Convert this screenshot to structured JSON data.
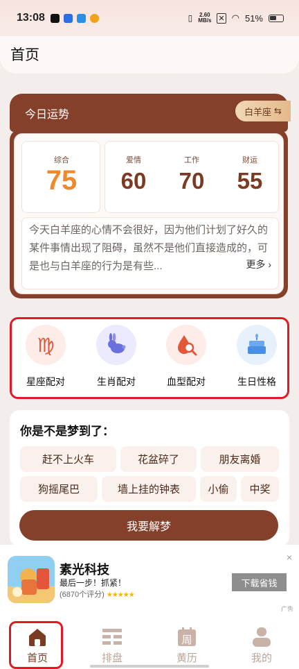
{
  "status": {
    "time": "13:08",
    "net_speed": "2.60",
    "net_unit": "MB/s",
    "battery": "51%"
  },
  "header": {
    "title": "首页"
  },
  "fortune": {
    "title": "今日运势",
    "zodiac": "白羊座",
    "zodiac_icon": "⇆",
    "scores": [
      {
        "label": "综合",
        "value": "75"
      },
      {
        "label": "爱情",
        "value": "60"
      },
      {
        "label": "工作",
        "value": "70"
      },
      {
        "label": "财运",
        "value": "55"
      }
    ],
    "description": "今天白羊座的心情不会很好，因为他们计划了好久的某件事情出现了阻碍，虽然不是他们直接造成的，可是也与白羊座的行为是有些...",
    "more": "更多 ›"
  },
  "tools": [
    {
      "label": "星座配对",
      "icon": "virgo-sign-icon",
      "color": "#e2563a",
      "bg": "#fdece7"
    },
    {
      "label": "生肖配对",
      "icon": "rabbit-icon",
      "color": "#6b6fe0",
      "bg": "#ecebfd"
    },
    {
      "label": "血型配对",
      "icon": "blood-drop-search-icon",
      "color": "#e2563a",
      "bg": "#fdece7"
    },
    {
      "label": "生日性格",
      "icon": "birthday-cake-icon",
      "color": "#4a90e2",
      "bg": "#e6f1fc"
    }
  ],
  "dream": {
    "title": "你是不是梦到了：",
    "chips": [
      "赶不上火车",
      "花盆碎了",
      "朋友离婚",
      "狗摇尾巴",
      "墙上挂的钟表",
      "小偷",
      "中奖"
    ],
    "button": "我要解梦"
  },
  "ad": {
    "title": "素光科技",
    "subtitle": "最后一步！抓紧！",
    "rating": "(6870个评分)",
    "stars": "★★★★★",
    "button": "下载省钱",
    "tag": "广告",
    "close": "×"
  },
  "tabs": [
    {
      "label": "首页",
      "icon": "home-icon",
      "active": true
    },
    {
      "label": "排盘",
      "icon": "chart-grid-icon",
      "active": false
    },
    {
      "label": "黄历",
      "icon": "calendar-week-icon",
      "active": false
    },
    {
      "label": "我的",
      "icon": "user-icon",
      "active": false
    }
  ],
  "colors": {
    "brand": "#84402a",
    "accent": "#ee8a2e",
    "highlight": "#e01a24"
  }
}
